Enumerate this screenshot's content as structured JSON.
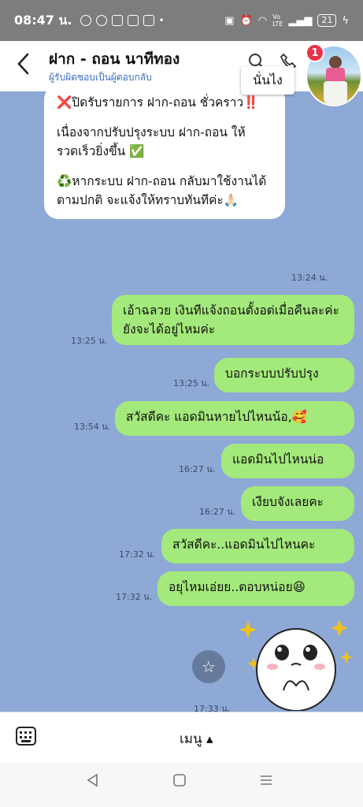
{
  "status_bar": {
    "time": "08:47 น.",
    "left_icons": [
      "messenger-icon",
      "line-icon",
      "line-app-icon",
      "chat-icon",
      "app-icon",
      "dot-icon"
    ],
    "right_icons": [
      "nfc-icon",
      "alarm-icon",
      "wifi-icon",
      "volte-icon",
      "signal-icon"
    ],
    "battery": "21"
  },
  "header": {
    "title": "ฝาก - ถอน นาทีทอง",
    "subtitle": "ผู้รับผิดชอบเป็นผู้ตอบกลับ",
    "back_icon": "chevron-left-icon"
  },
  "overlay": {
    "badge_count": "1",
    "tooltip": "นั่นไง"
  },
  "messages": {
    "announcement": {
      "line1": "❌ปิดรับรายการ ฝาก-ถอน ชั่วคราว‼️",
      "line2": "เนื่องจากปรับปรุงระบบ ฝาก-ถอน ให้รวดเร็วยิ่งขึ้น ✅",
      "line3": "♻️หากระบบ ฝาก-ถอน กลับมาใช้งานได้ตามปกติ จะแจ้งให้ทราบทันทีค่ะ🙏🏻",
      "time": "13:24 น."
    },
    "m1": {
      "text": "เอ้าฉลวย เงินทีแจ้งถอนตั้งอต่เมื่อคืนละค่ะยังจะได้อยู่ไหมค่ะ",
      "time": "13:25 น."
    },
    "m2": {
      "text": "บอกระบบปรับปรุง",
      "time": "13:25 น."
    },
    "m3": {
      "text": "สวัสดีคะ แอดมินหายไปไหนน้อ,🥰",
      "time": "13:54 น."
    },
    "m4": {
      "text": "แอดมินไปไหนน่อ",
      "time": "16:27 น."
    },
    "m5": {
      "text": "เงียบจังเลยคะ",
      "time": "16:27 น."
    },
    "m6": {
      "text": "สวัสดีคะ..แอดมินไปไหนคะ",
      "time": "17:32 น."
    },
    "m7": {
      "text": "อยุไหมเอ่ยย..ตอบหน่อย😆",
      "time": "17:32 น."
    },
    "sticker_time": "17:33 น."
  },
  "bottom_bar": {
    "menu_label": "เมนู ▴"
  },
  "colors": {
    "chat_bg": "#8ea9d6",
    "outgoing_bubble": "#a4e97b",
    "incoming_bubble": "#ffffff",
    "badge": "#e8344a"
  }
}
